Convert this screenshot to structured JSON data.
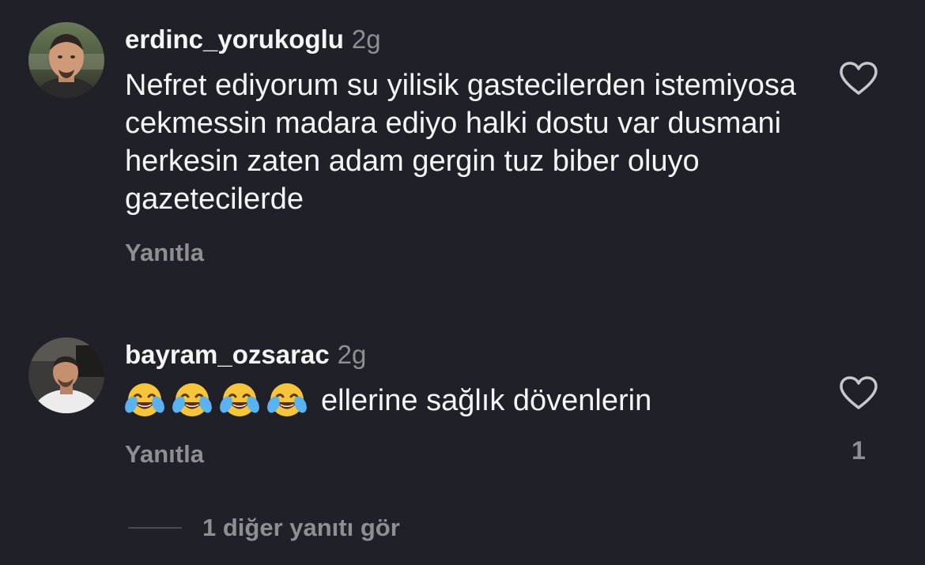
{
  "colors": {
    "background": "#202028",
    "primary_text": "#f5f5f5",
    "secondary_text": "#8e8e93"
  },
  "comments": [
    {
      "username": "erdinc_yorukoglu",
      "time": "2g",
      "text": "Nefret ediyorum su yilisik gastecilerden istemiyosa cekmessin madara ediyo halki dostu var dusmani herkesin zaten adam gergin tuz biber oluyo gazetecilerde",
      "reply_label": "Yanıtla",
      "like_icon": "heart-outline-icon",
      "like_count": ""
    },
    {
      "username": "bayram_ozsarac",
      "time": "2g",
      "emojis": [
        "face-with-tears-of-joy",
        "face-with-tears-of-joy",
        "face-with-tears-of-joy",
        "face-with-tears-of-joy"
      ],
      "text": "ellerine sağlık dövenlerin",
      "reply_label": "Yanıtla",
      "like_icon": "heart-outline-icon",
      "like_count": "1"
    }
  ],
  "view_more_replies": "1 diğer yanıtı gör"
}
